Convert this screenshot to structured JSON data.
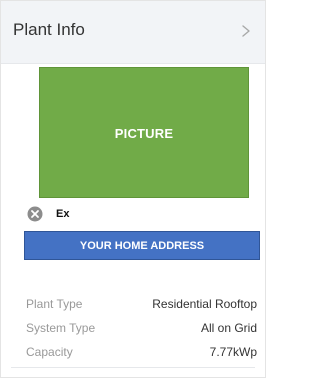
{
  "header": {
    "title": "Plant Info"
  },
  "photo": {
    "placeholder_label": "PICTURE"
  },
  "ex_label": "Ex",
  "address": {
    "label": "YOUR HOME ADDRESS"
  },
  "info": [
    {
      "label": "Plant Type",
      "value": "Residential Rooftop"
    },
    {
      "label": "System Type",
      "value": "All on Grid"
    },
    {
      "label": "Capacity",
      "value": "7.77kWp"
    }
  ],
  "colors": {
    "picture_fill": "#71ab48",
    "address_fill": "#4472c4",
    "header_bg": "#f2f4f7"
  },
  "icons": {
    "header_action": "chevron-right-icon",
    "remove": "close-circle-icon"
  }
}
